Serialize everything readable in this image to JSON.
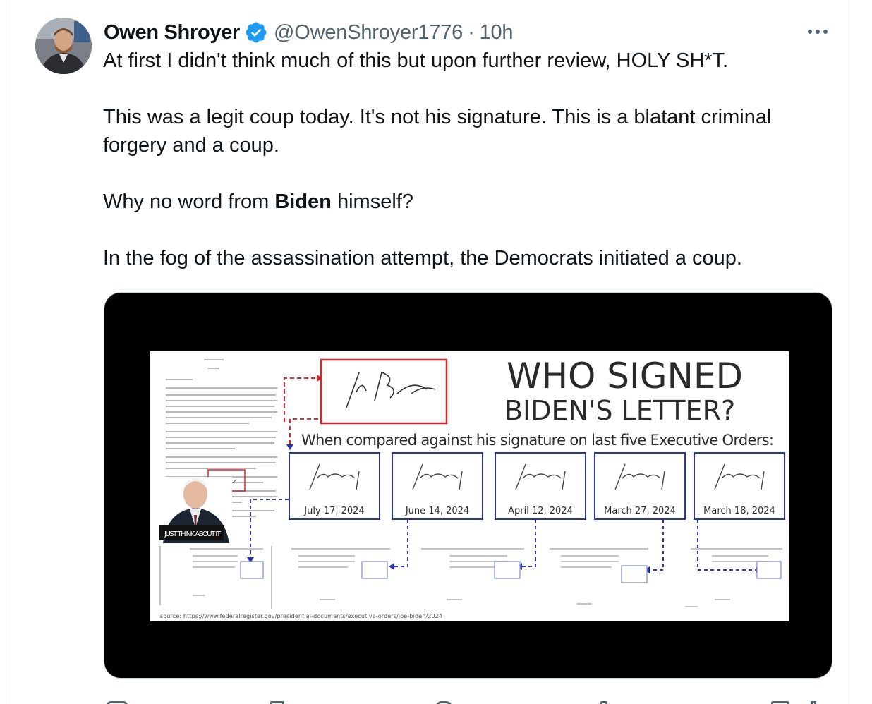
{
  "post": {
    "author_name": "Owen Shroyer",
    "handle": "@OwenShroyer1776",
    "separator": "·",
    "time": "10h",
    "verified_color": "#1d9bf0",
    "paragraphs": [
      {
        "before": "At first I didn't think much of this but upon further review, HOLY SH*T.",
        "bold": "",
        "after": ""
      },
      {
        "before": "This was a legit coup today. It's not his signature. This is a blatant criminal forgery and a coup.",
        "bold": "",
        "after": ""
      },
      {
        "before": "Why no word from ",
        "bold": "Biden",
        "after": " himself?"
      },
      {
        "before": "In the fog of the assassination attempt, the Democrats initiated a coup.",
        "bold": "",
        "after": ""
      }
    ]
  },
  "graphic": {
    "title_line1": "WHO SIGNED",
    "title_line2": "BIDEN'S LETTER?",
    "subtitle": "When compared against his signature on last five Executive Orders:",
    "dates": [
      "July 17, 2024",
      "June 14, 2024",
      "April 12, 2024",
      "March 27, 2024",
      "March 18, 2024"
    ],
    "caption": "JUST THINK ABOUT IT",
    "source": "source: https://www.federalregister.gov/presidential-documents/executive-orders/joe-biden/2024",
    "accent_red": "#d4262b",
    "accent_blue": "#2b35a8"
  }
}
